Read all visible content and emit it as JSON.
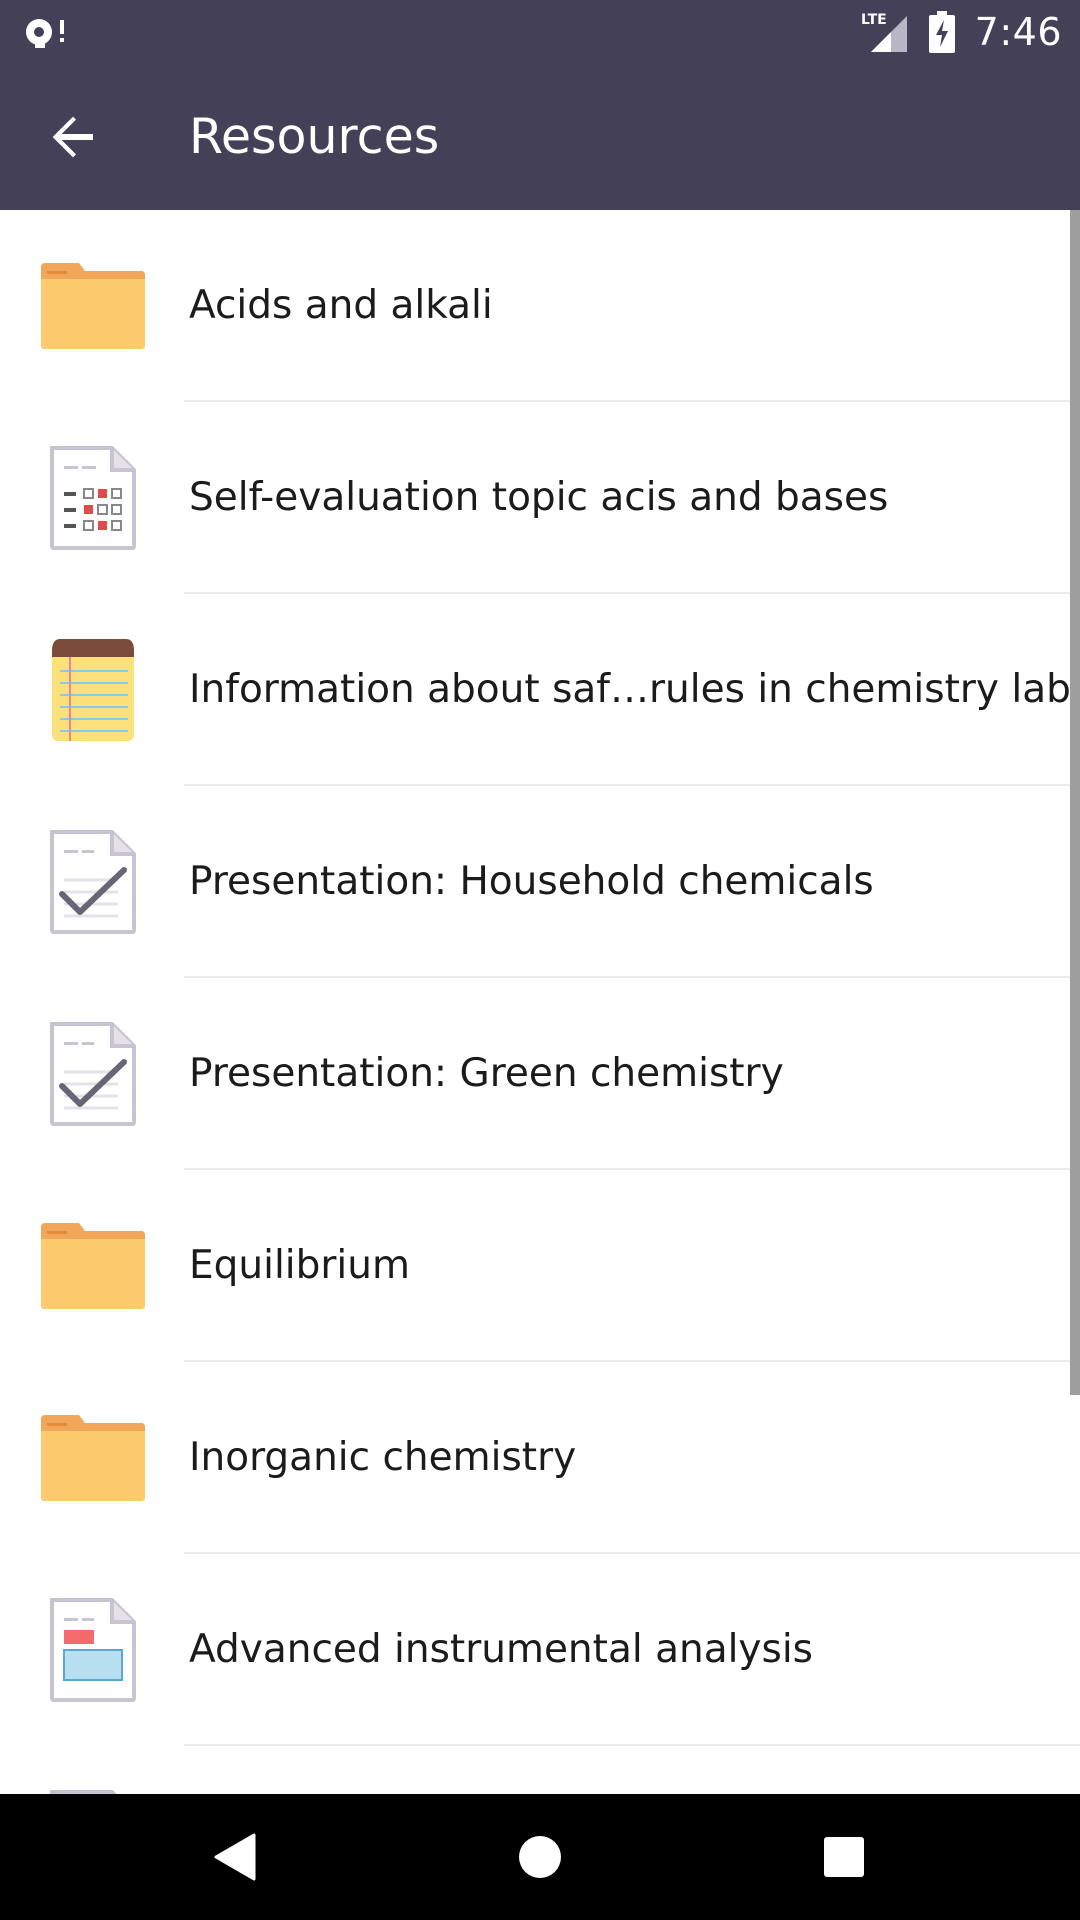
{
  "status_bar": {
    "time": "7:46",
    "network_label": "LTE",
    "icons": [
      "notification-icon",
      "lte-signal-icon",
      "battery-charging-icon"
    ]
  },
  "app_bar": {
    "title": "Resources",
    "back_icon": "arrow-back-icon"
  },
  "resources": [
    {
      "label": "Acids and alkali",
      "icon": "folder-icon"
    },
    {
      "label": "Self-evaluation topic acis and bases",
      "icon": "quiz-document-icon"
    },
    {
      "label": "Information about saf…rules in chemistry lab",
      "icon": "notepad-icon"
    },
    {
      "label": "Presentation: Household chemicals",
      "icon": "assignment-check-icon"
    },
    {
      "label": "Presentation: Green chemistry",
      "icon": "assignment-check-icon"
    },
    {
      "label": "Equilibrium",
      "icon": "folder-icon"
    },
    {
      "label": "Inorganic chemistry",
      "icon": "folder-icon"
    },
    {
      "label": "Advanced instrumental analysis",
      "icon": "page-document-icon"
    }
  ],
  "colors": {
    "app_bar": "#434058",
    "folder": "#FDCB6E",
    "folder_tab": "#F2A65A",
    "text": "#1B1B1B",
    "divider": "#ECECEC"
  },
  "nav_bar": {
    "icons": [
      "back-triangle-icon",
      "home-circle-icon",
      "recents-square-icon"
    ]
  }
}
